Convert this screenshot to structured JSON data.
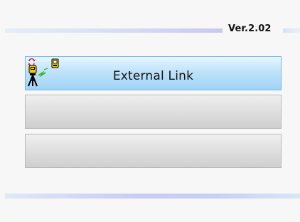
{
  "header": {
    "version_label": "Ver.2.02"
  },
  "menu": {
    "items": [
      {
        "label": "External Link",
        "icon": "external-link-icon",
        "state": "active"
      },
      {
        "label": "",
        "state": "empty"
      },
      {
        "label": "",
        "state": "empty"
      }
    ]
  },
  "colors": {
    "background": "#f7f7f7",
    "active_item": "#bfe3fa",
    "active_border": "#73b6e4",
    "inactive_item": "#dddddd",
    "band_accent": "#c8c8f2"
  }
}
